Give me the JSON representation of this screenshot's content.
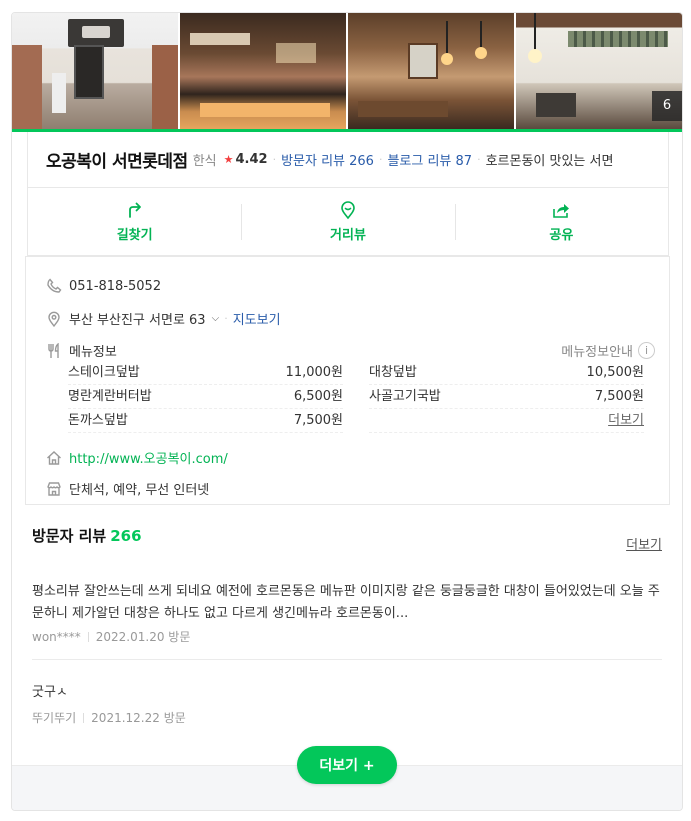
{
  "photos": {
    "count": "6"
  },
  "place": {
    "name": "오공복이 서면롯데점",
    "category": "한식",
    "rating": "4.42",
    "visitor_review_label": "방문자 리뷰 266",
    "blog_review_label": "블로그 리뷰 87",
    "description": "호르몬동이 맛있는 서면"
  },
  "actions": [
    {
      "label": "길찾기",
      "icon": "directions-icon"
    },
    {
      "label": "거리뷰",
      "icon": "street-view-icon"
    },
    {
      "label": "공유",
      "icon": "share-icon"
    }
  ],
  "detail": {
    "phone": "051-818-5052",
    "address": "부산 부산진구 서면로 63",
    "map_link": "지도보기",
    "menu_title": "메뉴정보",
    "menu_guide": "메뉴정보안내",
    "menu": [
      {
        "name": "스테이크덮밥",
        "price": "11,000원"
      },
      {
        "name": "대창덮밥",
        "price": "10,500원"
      },
      {
        "name": "명란계란버터밥",
        "price": "6,500원"
      },
      {
        "name": "사골고기국밥",
        "price": "7,500원"
      },
      {
        "name": "돈까스덮밥",
        "price": "7,500원"
      }
    ],
    "menu_more": "더보기",
    "website": "http://www.오공복이.com/",
    "facilities": "단체석, 예약, 무선 인터넷"
  },
  "reviews": {
    "title": "방문자 리뷰",
    "count": "266",
    "more": "더보기",
    "items": [
      {
        "text": "평소리뷰 잘안쓰는데 쓰게 되네요 예전에 호르몬동은 메뉴판 이미지랑 같은 둥글둥글한 대창이 들어있었는데 오늘 주문하니 제가알던 대창은 하나도 없고 다르게 생긴메뉴라 호르몬동이...",
        "author": "won****",
        "date": "2022.01.20 방문"
      },
      {
        "text": "굿구ㅅ",
        "author": "뚜기뚜기",
        "date": "2021.12.22 방문"
      }
    ],
    "load_more": "더보기 +"
  },
  "colors": {
    "accent": "#03c75a",
    "link": "#2a5caa",
    "star": "#f33f3f"
  }
}
